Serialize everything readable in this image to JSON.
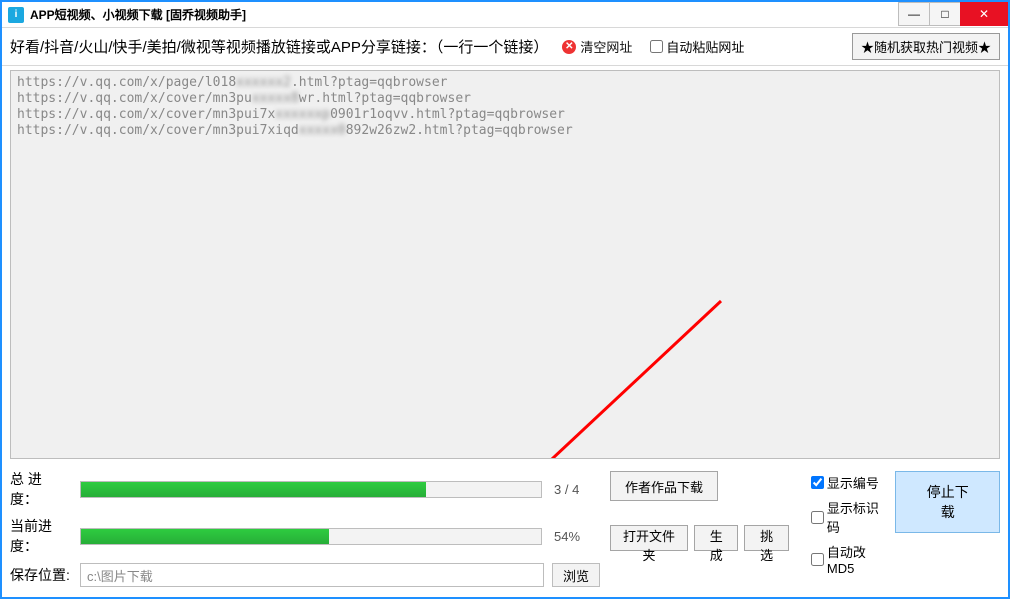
{
  "titlebar": {
    "icon_letter": "i",
    "title": "APP短视频、小视频下载 [固乔视频助手]"
  },
  "toolbar": {
    "label": "好看/抖音/火山/快手/美拍/微视等视频播放链接或APP分享链接：（一行一个链接）",
    "clear_label": "清空网址",
    "auto_paste_label": "自动粘贴网址",
    "random_button": "★随机获取热门视频★"
  },
  "urls": {
    "line1_a": "https://v.qq.com/x/page/l018",
    "line1_b": ".html?ptag=qqbrowser",
    "line2_a": "https://v.qq.com/x/cover/mn3pu",
    "line2_b": "wr.html?ptag=qqbrowser",
    "line3_a": "https://v.qq.com/x/cover/mn3pui7x",
    "line3_b": "0901r1oqvv.html?ptag=qqbrowser",
    "line4_a": "https://v.qq.com/x/cover/mn3pui7xiqd",
    "line4_b": "892w26zw2.html?ptag=qqbrowser"
  },
  "progress": {
    "total_label": "总 进 度：",
    "total_percent": 75,
    "total_text": "3 / 4",
    "current_label": "当前进度：",
    "current_percent": 54,
    "current_text": "54%"
  },
  "save": {
    "label": "保存位置:",
    "path": "c:\\图片下载",
    "browse": "浏览",
    "open_folder": "打开文件夹",
    "generate": "生成",
    "pick": "挑选"
  },
  "buttons": {
    "author_works": "作者作品下载",
    "stop_download": "停止下载"
  },
  "checks": {
    "show_index": "显示编号",
    "show_code": "显示标识码",
    "auto_md5": "自动改MD5"
  }
}
